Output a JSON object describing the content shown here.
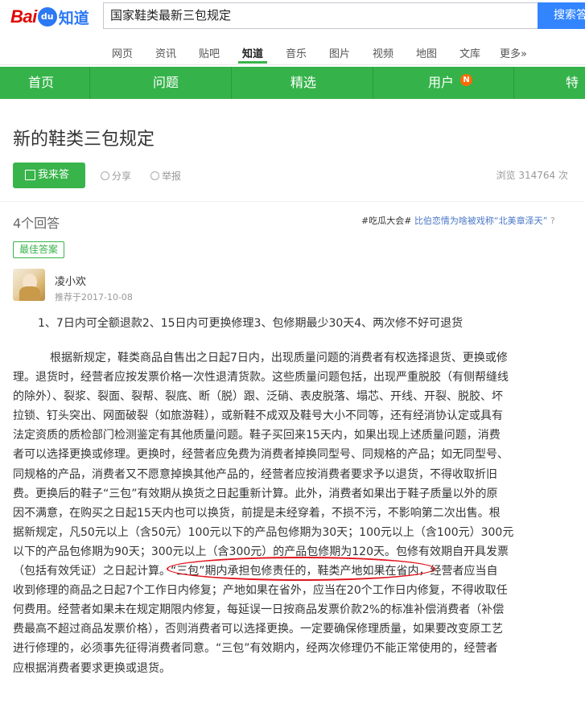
{
  "header": {
    "logo": {
      "bai": "Bai",
      "du": "du",
      "zhidao": "知道"
    },
    "search": {
      "value": "国家鞋类最新三包规定"
    },
    "search_button": "搜索答"
  },
  "category_nav": {
    "items": [
      "网页",
      "资讯",
      "贴吧",
      "知道",
      "音乐",
      "图片",
      "视频",
      "地图",
      "文库",
      "更多»"
    ],
    "active": "知道"
  },
  "green_nav": {
    "items": [
      "首页",
      "问题",
      "精选",
      "用户",
      "特色"
    ],
    "badge": "N",
    "colors": {
      "bg": "#35b34a",
      "badge": "#ff6a00"
    }
  },
  "question": {
    "title": "新的鞋类三包规定",
    "answer_button": "我来答",
    "share": "分享",
    "report": "举报",
    "views": "浏览 314764 次"
  },
  "answers": {
    "count_label": "4个回答",
    "topic": {
      "tag": "#吃瓜大会#",
      "text": "比伯恋情为啥被戏称“北美章泽天”",
      "help": "?"
    },
    "best_label": "最佳答案",
    "best": {
      "user": "凌小欢",
      "recommended": "推荐于2017-10-08",
      "summary": "1、7日内可全额退款2、15日内可更换修理3、包修期最少30天4、两次修不好可退货",
      "lines": [
        "根据新规定，鞋类商品自售出之日起7日内，出现质量问题的消费者有权选择退货、更换或修",
        "理。退货时，经营者应按发票价格一次性退清货款。这些质量问题包括，出现严重脱胶（有侧帮缝线",
        "的除外）、裂浆、裂面、裂帮、裂底、断（脱）跟、泛硝、表皮脱落、塌芯、开线、开裂、脱胶、坏",
        "拉锁、钉头突出、网面破裂（如旅游鞋），或新鞋不成双及鞋号大小不同等，还有经消协认定或具有",
        "法定资质的质检部门检测鉴定有其他质量问题。鞋子买回来15天内，如果出现上述质量问题，消费",
        "者可以选择更换或修理。更换时，经营者应免费为消费者掉换同型号、同规格的产品；如无同型号、",
        "同规格的产品，消费者又不愿意掉换其他产品的，经营者应按消费者要求予以退货，不得收取折旧",
        "费。更换后的鞋子“三包”有效期从换货之日起重新计算。此外，消费者如果出于鞋子质量以外的原",
        "因不满意，在购买之日起15天内也可以换货，前提是未经穿着，不损不污，不影响第二次出售。根",
        "据新规定，凡50元以上（含50元）100元以下的产品包修期为30天；100元以上（含100元）300元",
        "以下的产品包修期为90天；300元以上（含300元）的产品包修期为120天。包修有效期自开具发票",
        "（包括有效凭证）之日起计算。“三包”期内承担包修责任的，鞋类产地如果在省内，经营者应当自",
        "收到修理的商品之日起7个工作日内修复；产地如果在省外，应当在20个工作日内修复，不得收取任",
        "何费用。经营者如果未在规定期限内修复，每延误一日按商品发票价款2%的标准补偿消费者（补偿",
        "费最高不超过商品发票价格），否则消费者可以选择更换。一定要确保修理质量，如果要改变原工艺",
        "进行修理的，必须事先征得消费者同意。“三包”有效期内，经两次修理仍不能正常使用的，经营者",
        "应根据消费者要求更换或退货。"
      ]
    }
  }
}
